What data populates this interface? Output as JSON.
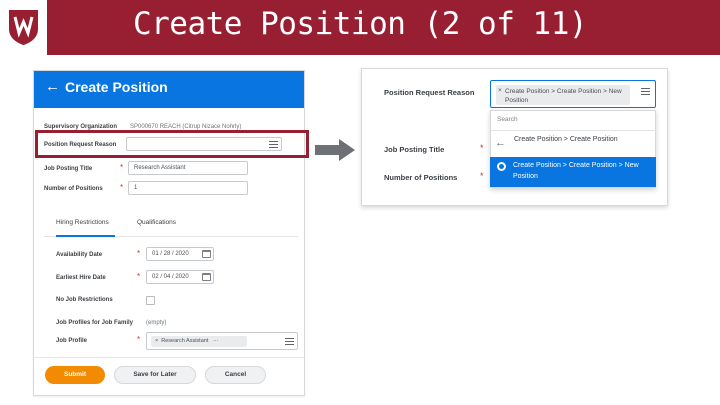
{
  "slide": {
    "title": "Create Position (2 of 11)",
    "header_color": "#981e32"
  },
  "form": {
    "title": "Create Position",
    "back_icon": "arrow-left-icon",
    "accent": "#0875e1",
    "fields": {
      "supervisory_org_label": "Supervisory Organization",
      "supervisory_org_value": "SP000670 REACH (Citrup Nizace Nohrly)",
      "position_request_reason_label": "Position Request Reason",
      "job_posting_title_label": "Job Posting Title",
      "job_posting_title_value": "Research Assistant",
      "number_of_positions_label": "Number of Positions",
      "number_of_positions_value": "1"
    },
    "tabs": [
      "Hiring Restrictions",
      "Qualifications"
    ],
    "hiring": {
      "availability_date_label": "Availability Date",
      "availability_date_value": "01 / 28 / 2020",
      "earliest_hire_date_label": "Earliest Hire Date",
      "earliest_hire_date_value": "02 / 04 / 2020",
      "no_job_restrictions_label": "No Job Restrictions",
      "job_profiles_label": "Job Profiles for Job Family",
      "job_profiles_value": "(empty)",
      "job_profile_label": "Job Profile",
      "job_profile_value": "Research Assistant",
      "job_profile_more": "···"
    },
    "required_mark": "*",
    "buttons": {
      "submit": "Submit",
      "save_for_later": "Save for Later",
      "cancel": "Cancel"
    },
    "submit_color": "#f38b00"
  },
  "zoom": {
    "position_request_reason_label": "Position Request Reason",
    "selected_value": "Create Position > Create Position > New Position",
    "search_placeholder": "Search",
    "option_parent": "Create Position > Create Position",
    "option_selected": "Create Position > Create Position > New Position",
    "job_posting_title_label": "Job Posting Title",
    "number_of_positions_label": "Number of Positions",
    "required_mark": "*"
  },
  "remove_mark": "×"
}
